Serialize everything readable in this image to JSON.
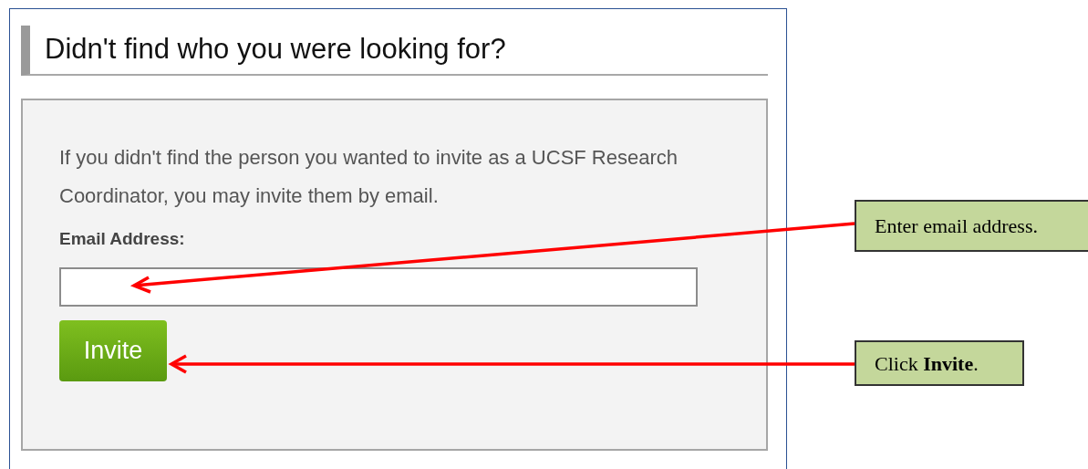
{
  "panel": {
    "heading": "Didn't find who you were looking for?",
    "intro": "If you didn't find the person you wanted to invite as a UCSF Research Coordinator, you may invite them by email.",
    "email_label": "Email Address:",
    "invite_button": "Invite"
  },
  "callouts": [
    {
      "text": "Enter email address."
    },
    {
      "text": "Click **Invite**."
    }
  ]
}
